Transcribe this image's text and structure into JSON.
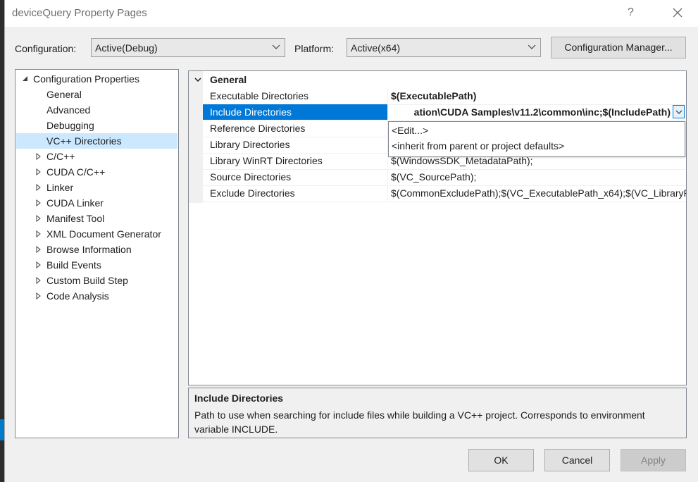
{
  "window": {
    "title": "deviceQuery Property Pages",
    "help_glyph": "?"
  },
  "config": {
    "configuration_label": "Configuration:",
    "configuration_value": "Active(Debug)",
    "platform_label": "Platform:",
    "platform_value": "Active(x64)",
    "manager_button": "Configuration Manager..."
  },
  "tree": {
    "items": [
      {
        "label": "Configuration Properties",
        "level": 0,
        "expander": "expanded"
      },
      {
        "label": "General",
        "level": 1,
        "expander": "none"
      },
      {
        "label": "Advanced",
        "level": 1,
        "expander": "none"
      },
      {
        "label": "Debugging",
        "level": 1,
        "expander": "none"
      },
      {
        "label": "VC++ Directories",
        "level": 1,
        "expander": "none",
        "selected": true
      },
      {
        "label": "C/C++",
        "level": 1,
        "expander": "collapsed"
      },
      {
        "label": "CUDA C/C++",
        "level": 1,
        "expander": "collapsed"
      },
      {
        "label": "Linker",
        "level": 1,
        "expander": "collapsed"
      },
      {
        "label": "CUDA Linker",
        "level": 1,
        "expander": "collapsed"
      },
      {
        "label": "Manifest Tool",
        "level": 1,
        "expander": "collapsed"
      },
      {
        "label": "XML Document Generator",
        "level": 1,
        "expander": "collapsed"
      },
      {
        "label": "Browse Information",
        "level": 1,
        "expander": "collapsed"
      },
      {
        "label": "Build Events",
        "level": 1,
        "expander": "collapsed"
      },
      {
        "label": "Custom Build Step",
        "level": 1,
        "expander": "collapsed"
      },
      {
        "label": "Code Analysis",
        "level": 1,
        "expander": "collapsed"
      }
    ]
  },
  "grid": {
    "category": "General",
    "rows": [
      {
        "name": "Executable Directories",
        "value": "$(ExecutablePath)"
      },
      {
        "name": "Include Directories",
        "value": "ation\\CUDA Samples\\v11.2\\common\\inc;$(IncludePath)"
      },
      {
        "name": "Reference Directories",
        "value": ""
      },
      {
        "name": "Library Directories",
        "value": ""
      },
      {
        "name": "Library WinRT Directories",
        "value": "$(WindowsSDK_MetadataPath);"
      },
      {
        "name": "Source Directories",
        "value": "$(VC_SourcePath);"
      },
      {
        "name": "Exclude Directories",
        "value": "$(CommonExcludePath);$(VC_ExecutablePath_x64);$(VC_LibraryPath"
      }
    ],
    "dropdown_options": [
      "<Edit...>",
      "<inherit from parent or project defaults>"
    ]
  },
  "description": {
    "title": "Include Directories",
    "text": "Path to use when searching for include files while building a VC++ project.  Corresponds to environment variable INCLUDE."
  },
  "buttons": {
    "ok": "OK",
    "cancel": "Cancel",
    "apply": "Apply"
  },
  "colors": {
    "selection": "#0078d7",
    "tree_selection": "#cce8ff",
    "dialog_bg": "#f0f0f0"
  }
}
